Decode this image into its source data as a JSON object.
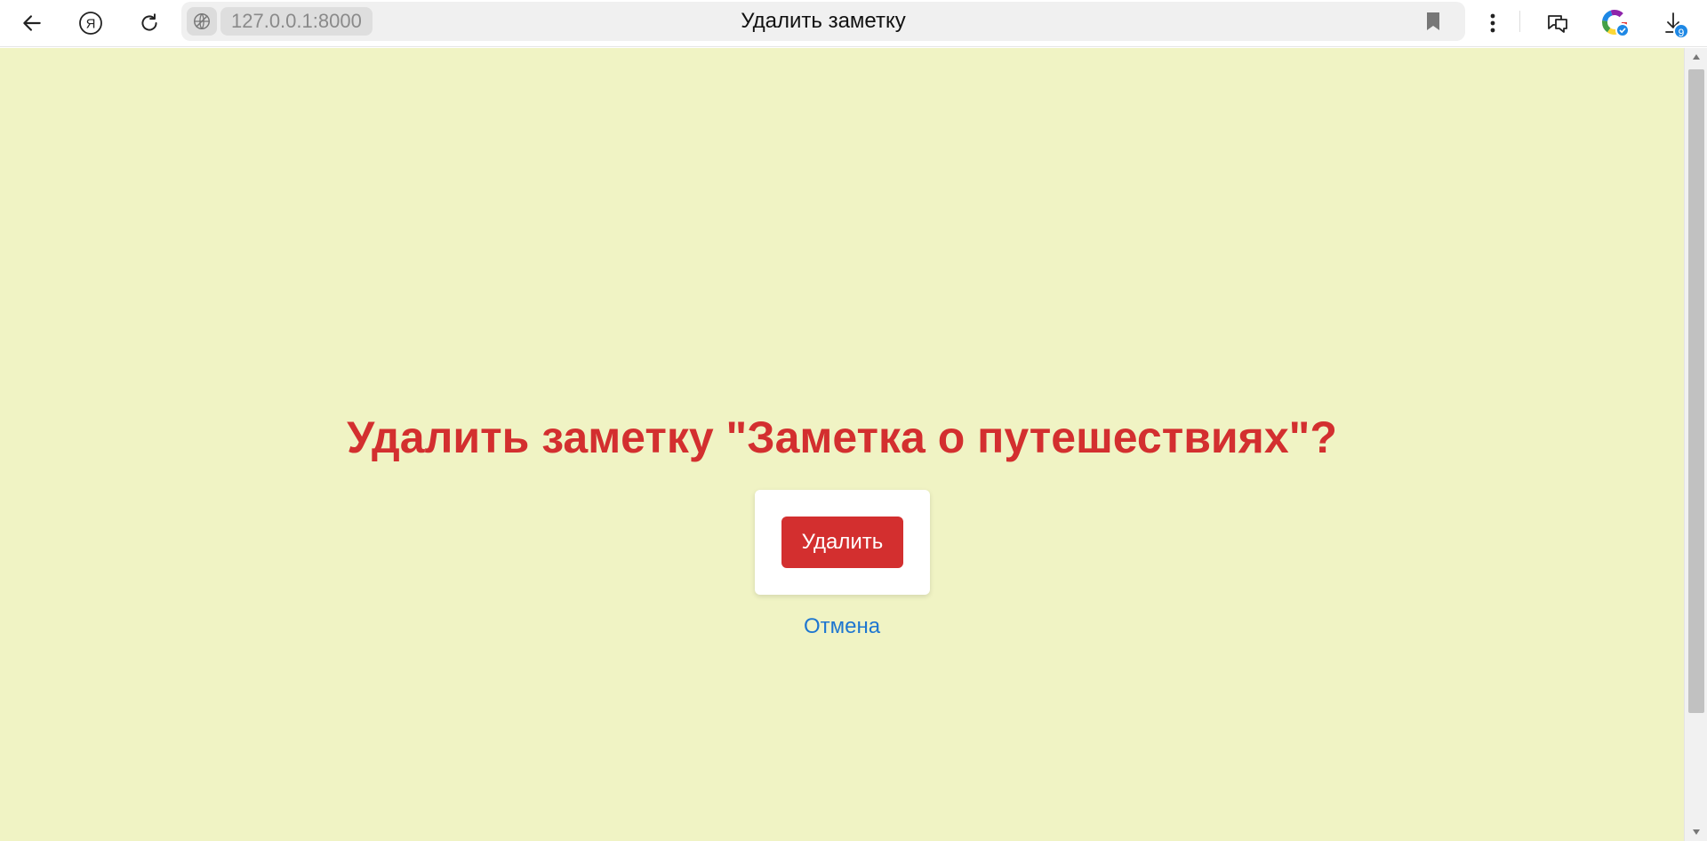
{
  "browser": {
    "url": "127.0.0.1:8000",
    "tab_title": "Удалить заметку",
    "downloads_count": "9",
    "icons": {
      "back": "back-arrow-icon",
      "yandex": "yandex-icon",
      "reload": "reload-icon",
      "site": "site-info-icon",
      "bookmark": "bookmark-icon",
      "menu": "more-menu-icon",
      "chat": "chat-icon",
      "color": "color-wheel-icon",
      "downloads": "download-icon"
    }
  },
  "page": {
    "heading": "Удалить заметку \"Заметка о путешествиях\"?",
    "delete_label": "Удалить",
    "cancel_label": "Отмена",
    "colors": {
      "background": "#f0f3c4",
      "accent_red": "#d32f2f",
      "link_blue": "#1e76d0"
    }
  }
}
